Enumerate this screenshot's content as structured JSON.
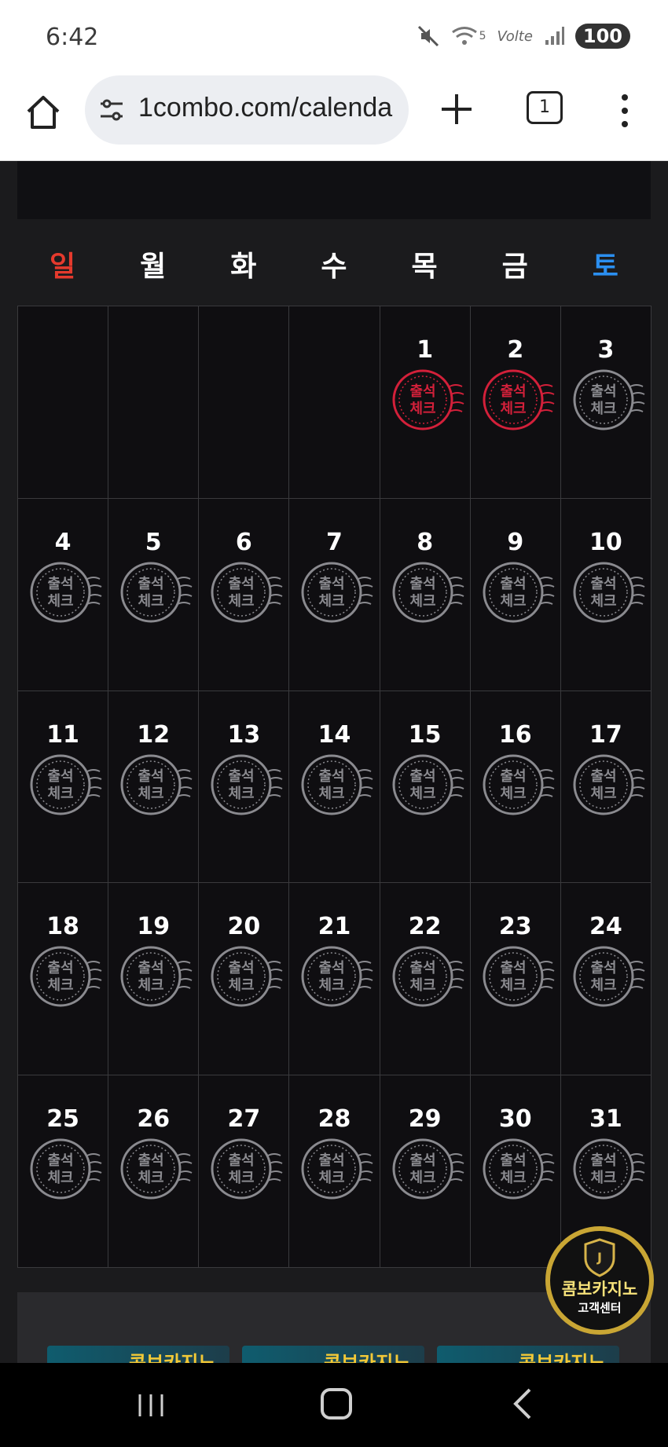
{
  "status": {
    "time": "6:42",
    "network": "Volte",
    "signal_label": "5",
    "battery": "100"
  },
  "browser": {
    "url": "1combo.com/calenda",
    "tab_count": "1"
  },
  "calendar": {
    "weekdays": [
      {
        "label": "일",
        "color": "#e53a2d"
      },
      {
        "label": "월",
        "color": "#ffffff"
      },
      {
        "label": "화",
        "color": "#ffffff"
      },
      {
        "label": "수",
        "color": "#ffffff"
      },
      {
        "label": "목",
        "color": "#ffffff"
      },
      {
        "label": "금",
        "color": "#ffffff"
      },
      {
        "label": "토",
        "color": "#2b8ff0"
      }
    ],
    "stamp_text": [
      "출석",
      "체크"
    ],
    "checked_days": [
      1,
      2
    ],
    "leading_blanks": 4,
    "days_in_month": 31
  },
  "banner_text": "콤보카지노",
  "support": {
    "title": "콤보카지노",
    "subtitle": "고객센터"
  },
  "colors": {
    "stamp_checked": "#d3203a",
    "stamp_unchecked": "#8a8a8f"
  }
}
